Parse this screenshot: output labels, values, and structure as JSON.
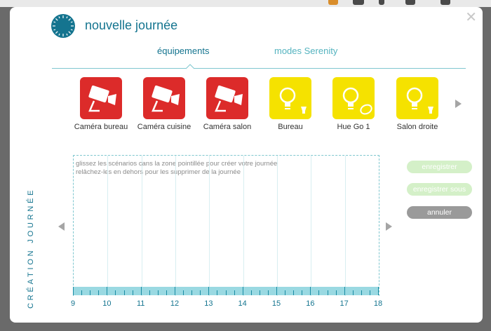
{
  "header": {
    "title": "nouvelle journée"
  },
  "tabs": [
    {
      "label": "équipements"
    },
    {
      "label": "modes Serenity"
    }
  ],
  "devices": [
    {
      "label": "Caméra bureau",
      "type": "camera",
      "color": "#dc2b2a"
    },
    {
      "label": "Caméra cuisine",
      "type": "camera",
      "color": "#dc2b2a"
    },
    {
      "label": "Caméra salon",
      "type": "camera",
      "color": "#dc2b2a"
    },
    {
      "label": "Bureau",
      "type": "bulb",
      "color": "#f5e200"
    },
    {
      "label": "Hue Go 1",
      "type": "hue-go",
      "color": "#f5e200"
    },
    {
      "label": "Salon droite",
      "type": "bulb",
      "color": "#f5e200"
    }
  ],
  "sidebar": {
    "vertical_title": "CRÉATION JOURNÉE"
  },
  "timeline": {
    "hint_line1": "glissez les scénarios cans la zone pointillée pour créer votre journée",
    "hint_line2": "relâchez-les en dehors pour les supprimer de la journée",
    "hours": [
      "9",
      "10",
      "11",
      "12",
      "13",
      "14",
      "15",
      "16",
      "17",
      "18"
    ]
  },
  "actions": {
    "save": "enregistrer",
    "save_as": "enregistrer sous",
    "cancel": "annuler"
  },
  "colors": {
    "accent": "#14748f",
    "secondary": "#54b3bf",
    "camera_tile": "#dc2b2a",
    "light_tile": "#f5e200"
  }
}
